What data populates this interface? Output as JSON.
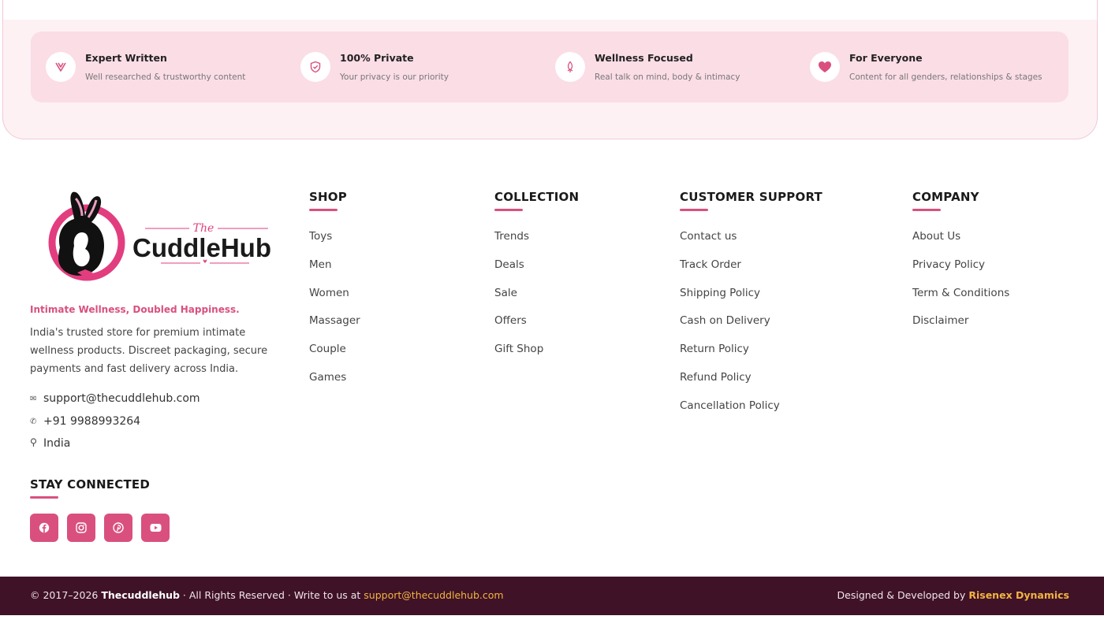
{
  "features": [
    {
      "icon": "v-check-icon",
      "title": "Expert Written",
      "subtitle": "Well researched & trustworthy content"
    },
    {
      "icon": "shield-check-icon",
      "title": "100% Private",
      "subtitle": "Your privacy is our priority"
    },
    {
      "icon": "leaf-icon",
      "title": "Wellness Focused",
      "subtitle": "Real talk on mind, body & intimacy"
    },
    {
      "icon": "heart-icon",
      "title": "For Everyone",
      "subtitle": "Content for all genders, relationships & stages"
    }
  ],
  "brand": {
    "logo_small": "The",
    "logo_text": "CuddleHub",
    "tagline": "Intimate Wellness, Doubled Happiness.",
    "about": "India's trusted store for premium intimate wellness products. Discreet packaging, secure payments and fast delivery across India.",
    "email": "support@thecuddlehub.com",
    "phone": "+91 9988993264",
    "location": "India"
  },
  "columns": {
    "shop": {
      "title": "SHOP",
      "links": [
        "Toys",
        "Men",
        "Women",
        "Massager",
        "Couple",
        "Games"
      ]
    },
    "collection": {
      "title": "COLLECTION",
      "links": [
        "Trends",
        "Deals",
        "Sale",
        "Offers",
        "Gift Shop"
      ]
    },
    "support": {
      "title": "CUSTOMER SUPPORT",
      "links": [
        "Contact us",
        "Track Order",
        "Shipping Policy",
        "Cash on Delivery",
        "Return Policy",
        "Refund Policy",
        "Cancellation Policy"
      ]
    },
    "company": {
      "title": "COMPANY",
      "links": [
        "About Us",
        "Privacy Policy",
        "Term & Conditions",
        "Disclaimer"
      ]
    }
  },
  "social": {
    "title": "STAY CONNECTED",
    "icons": [
      "facebook-icon",
      "instagram-icon",
      "pinterest-icon",
      "youtube-icon"
    ]
  },
  "bottom": {
    "copyright_prefix": "© 2017–2026 ",
    "brand": "Thecuddlehub",
    "middle": " · All Rights Reserved · Write to us at ",
    "email": "support@thecuddlehub.com",
    "designed_by": "Designed & Developed by ",
    "developer": "Risenex Dynamics"
  },
  "colors": {
    "accent": "#d9507e",
    "bottom_bar": "#3f1227",
    "highlight": "#f2b441"
  }
}
